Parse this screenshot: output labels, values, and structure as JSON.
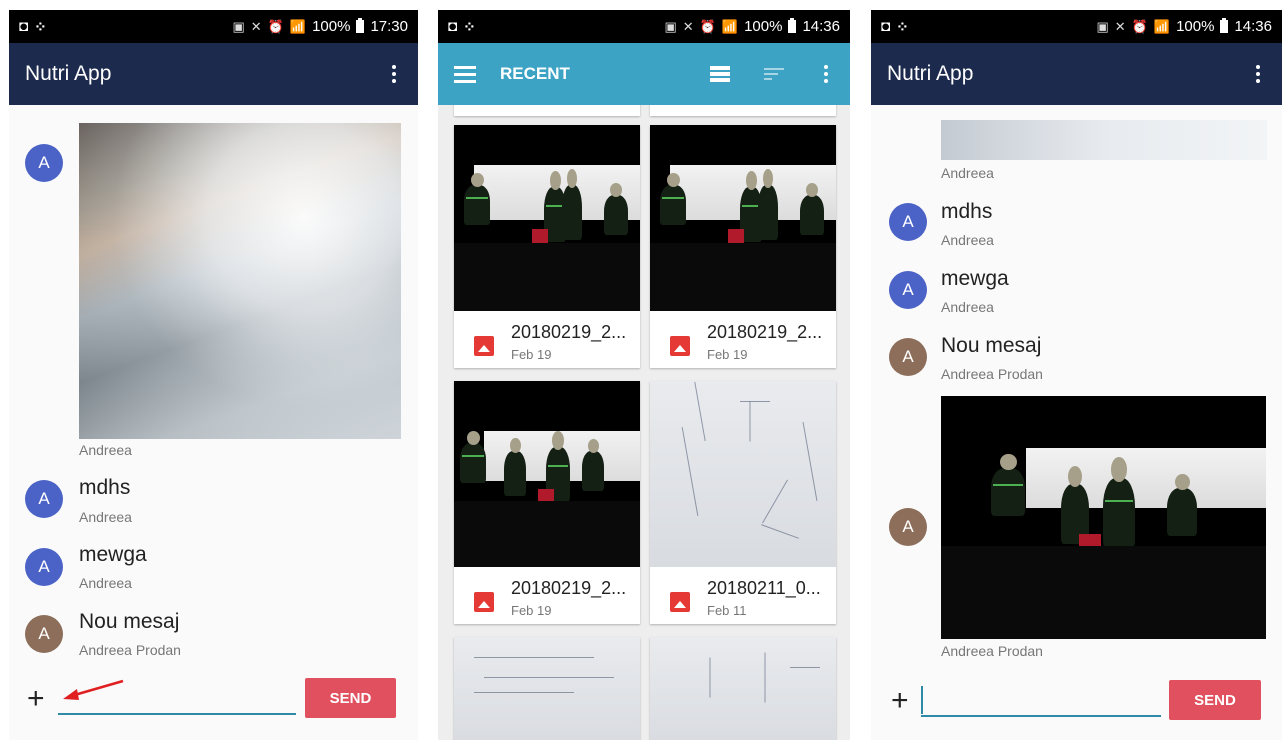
{
  "phone1": {
    "status_time": "17:30",
    "status_battery": "100%",
    "app_title": "Nutri App",
    "image_message": {
      "avatar": "A",
      "author": "Andreea"
    },
    "messages": [
      {
        "avatar": "A",
        "title": "mdhs",
        "author": "Andreea",
        "color": "#4b63c7"
      },
      {
        "avatar": "A",
        "title": "mewga",
        "author": "Andreea",
        "color": "#4b63c7"
      },
      {
        "avatar": "A",
        "title": "Nou mesaj",
        "author": "Andreea Prodan",
        "color": "#8d6e5a"
      }
    ],
    "composer": {
      "plus": "+",
      "send_label": "SEND",
      "input_placeholder": ""
    }
  },
  "phone2": {
    "status_time": "14:36",
    "status_battery": "100%",
    "title": "RECENT",
    "files": [
      {
        "name": "20180219_2...",
        "date": "Feb 19",
        "kind": "concert"
      },
      {
        "name": "20180219_2...",
        "date": "Feb 19",
        "kind": "concert"
      },
      {
        "name": "20180219_2...",
        "date": "Feb 19",
        "kind": "concert"
      },
      {
        "name": "20180211_0...",
        "date": "Feb 11",
        "kind": "paper"
      }
    ]
  },
  "phone3": {
    "status_time": "14:36",
    "status_battery": "100%",
    "app_title": "Nutri App",
    "top_author": "Andreea",
    "messages": [
      {
        "avatar": "A",
        "title": "mdhs",
        "author": "Andreea",
        "color": "#4b63c7"
      },
      {
        "avatar": "A",
        "title": "mewga",
        "author": "Andreea",
        "color": "#4b63c7"
      },
      {
        "avatar": "A",
        "title": "Nou mesaj",
        "author": "Andreea Prodan",
        "color": "#8d6e5a"
      }
    ],
    "image_message": {
      "avatar": "A",
      "author": "Andreea Prodan"
    },
    "composer": {
      "plus": "+",
      "send_label": "SEND"
    }
  },
  "colors": {
    "appbar_navy": "#1c2b4d",
    "appbar_blue": "#3da3c4",
    "send_red": "#e0505f",
    "input_accent": "#2f8aa7",
    "avatar_blue": "#4b63c7",
    "avatar_brown": "#8d6e5a",
    "annotation_arrow": "#e02020"
  }
}
